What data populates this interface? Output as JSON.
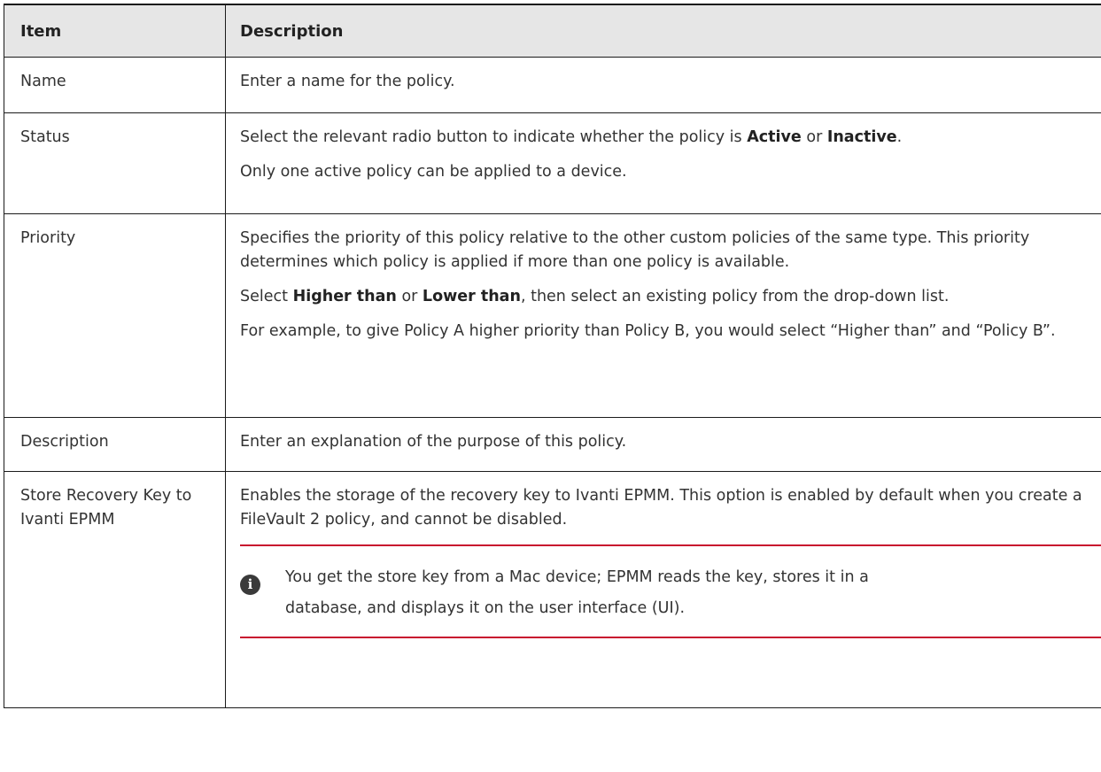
{
  "table": {
    "headers": {
      "item": "Item",
      "description": "Description"
    },
    "rows": {
      "name": {
        "item": "Name",
        "desc": "Enter a name for the policy."
      },
      "status": {
        "item": "Status",
        "p1_pre": "Select the relevant radio button to indicate whether the policy is ",
        "p1_b1": "Active",
        "p1_mid": " or ",
        "p1_b2": "Inactive",
        "p1_post": ".",
        "p2": "Only one active policy can be applied to a device."
      },
      "priority": {
        "item": "Priority",
        "p1": "Specifies the priority of this policy relative to the other custom policies of the same type. This priority determines which policy is applied if more than one policy is available.",
        "p2_pre": "Select ",
        "p2_b1": "Higher than",
        "p2_mid": " or ",
        "p2_b2": "Lower than",
        "p2_post": ", then select an existing policy from the drop-down list.",
        "p3": "For example, to give Policy A higher priority than Policy B, you would select “Higher than” and “Policy B”."
      },
      "description": {
        "item": "Description",
        "desc": "Enter an explanation of the purpose of this policy."
      },
      "store": {
        "item": "Store Recovery Key to Ivanti EPMM",
        "p1": "Enables the storage of the recovery key to Ivanti EPMM. This option is enabled by default when you create a FileVault 2 policy, and cannot be disabled.",
        "note_icon": "info-icon",
        "note_icon_glyph": "i",
        "note": "You get the store key from a Mac device; EPMM reads the key, stores it in a database, and displays it on the user interface (UI)."
      }
    }
  },
  "colors": {
    "header_bg": "#e6e6e6",
    "note_border": "#c8102e",
    "text": "#333333"
  }
}
